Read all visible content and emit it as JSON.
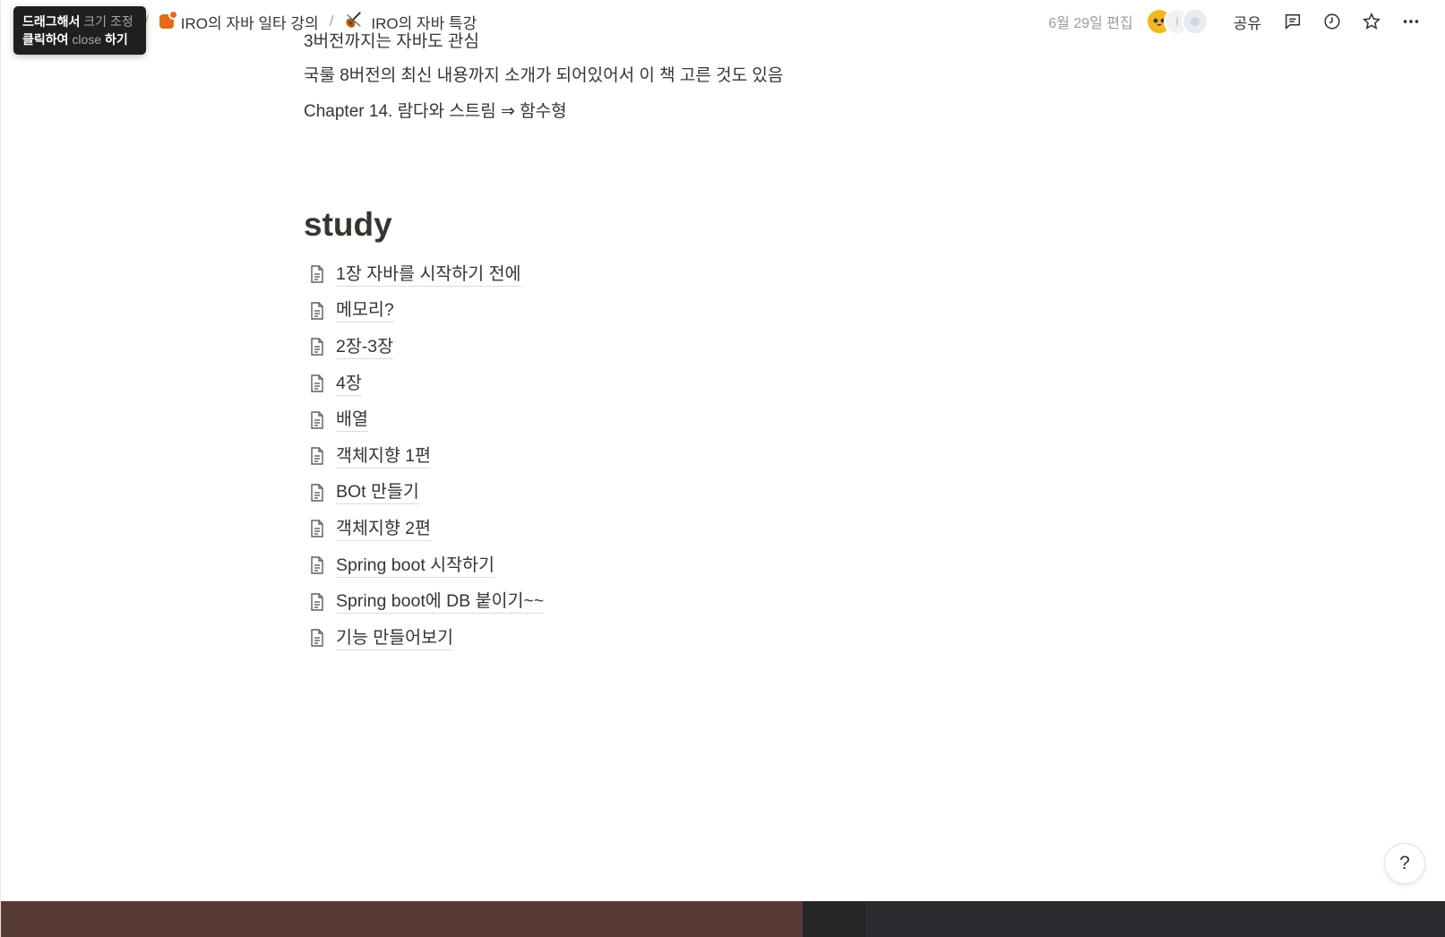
{
  "tooltip": {
    "line1_bold": "드래그해서",
    "line1_muted": " 크기 조정",
    "line2_bold": "클릭하여",
    "line2_muted": " close",
    "line2_end": " 하기"
  },
  "breadcrumb": {
    "separator": "/",
    "items": [
      {
        "label": "IRO의 자바 일타 강의",
        "icon": "orange-page-icon"
      },
      {
        "label": "IRO의 자바 특강",
        "icon": "violin-icon"
      }
    ]
  },
  "topbar": {
    "edited": "6월 29일 편집",
    "share_label": "공유",
    "icons": [
      "comment-icon",
      "history-clock-icon",
      "favorite-star-icon",
      "more-icon"
    ]
  },
  "content": {
    "cut_line": "3버전까지는 자바도 관심",
    "paragraphs": [
      "국룰 8버전의 최신 내용까지 소개가 되어있어서 이 책 고른 것도 있음",
      "Chapter 14. 람다와 스트림 ⇒ 함수형"
    ],
    "heading": "study",
    "pages": [
      "1장 자바를 시작하기 전에",
      "메모리?",
      "2장-3장",
      "4장",
      "배열",
      "객체지향 1편",
      "BOt 만들기",
      "객체지향 2편",
      "Spring boot 시작하기",
      "Spring boot에 DB 붙이기~~",
      "기능 만들어보기"
    ]
  },
  "help_label": "?"
}
